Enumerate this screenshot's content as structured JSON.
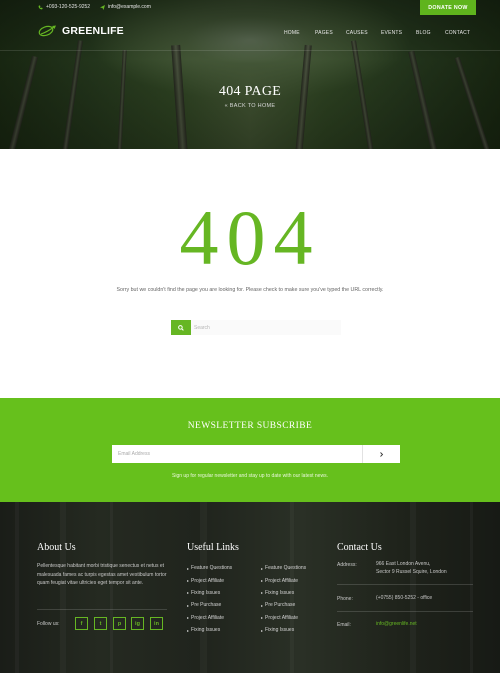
{
  "topbar": {
    "phone": "+093-120-525-9252",
    "email": "info@example.com",
    "donate_label": "DONATE NOW"
  },
  "brand": {
    "logo_text": "GREENLIFE"
  },
  "nav": {
    "items": [
      {
        "label": "HOME"
      },
      {
        "label": "PAGES"
      },
      {
        "label": "CAUSES"
      },
      {
        "label": "EVENTS"
      },
      {
        "label": "BLOG"
      },
      {
        "label": "CONTACT"
      }
    ]
  },
  "hero": {
    "title": "404 PAGE",
    "breadcrumb": "« BACK TO HOME"
  },
  "error": {
    "code": "404",
    "message": "Sorry but we couldn't find the page you are looking for. Please check to make sure you've typed the URL correctly.",
    "search_placeholder": "Search"
  },
  "newsletter": {
    "title": "NEWSLETTER SUBSCRIBE",
    "input_placeholder": "Email Address",
    "note": "Sign up for regular newsletter and stay up to date with our latest news."
  },
  "footer": {
    "about": {
      "heading": "About Us",
      "text": "Pellentesque habitant morbi tristique senectus et netus et malesuada fames ac turpis egestas amet vestibulum tortor quam feugiat vitae ultricies eget tempor sit ante.",
      "follow_label": "Follow us:",
      "social": [
        {
          "label": "f",
          "icon": "facebook-icon"
        },
        {
          "label": "t",
          "icon": "twitter-icon"
        },
        {
          "label": "p",
          "icon": "pinterest-icon"
        },
        {
          "label": "ig",
          "icon": "instagram-icon"
        },
        {
          "label": "in",
          "icon": "linkedin-icon"
        }
      ]
    },
    "links": {
      "heading": "Useful Links",
      "col1": [
        {
          "label": "Feature Questions"
        },
        {
          "label": "Project Affiliate"
        },
        {
          "label": "Fixing Issues"
        },
        {
          "label": "Pre Purchase"
        },
        {
          "label": "Project Affiliate"
        },
        {
          "label": "Fixing Issues"
        }
      ],
      "col2": [
        {
          "label": "Feature Questions"
        },
        {
          "label": "Project Affiliate"
        },
        {
          "label": "Fixing Issues"
        },
        {
          "label": "Pre Purchase"
        },
        {
          "label": "Project Affiliate"
        },
        {
          "label": "Fixing Issues"
        }
      ]
    },
    "contact": {
      "heading": "Contact Us",
      "address_label": "Address:",
      "address_line1": "966 East London Avenu,",
      "address_line2": "Sector 9 Russel Squire, London",
      "phone_label": "Phone:",
      "phone_value": "(+0755) 850-5252 - office",
      "email_label": "Email:",
      "email_value": "info@greenlife.net"
    }
  },
  "colors": {
    "accent": "#66b623",
    "newsletter_bg": "#66c01c",
    "footer_bg": "#20241d"
  }
}
